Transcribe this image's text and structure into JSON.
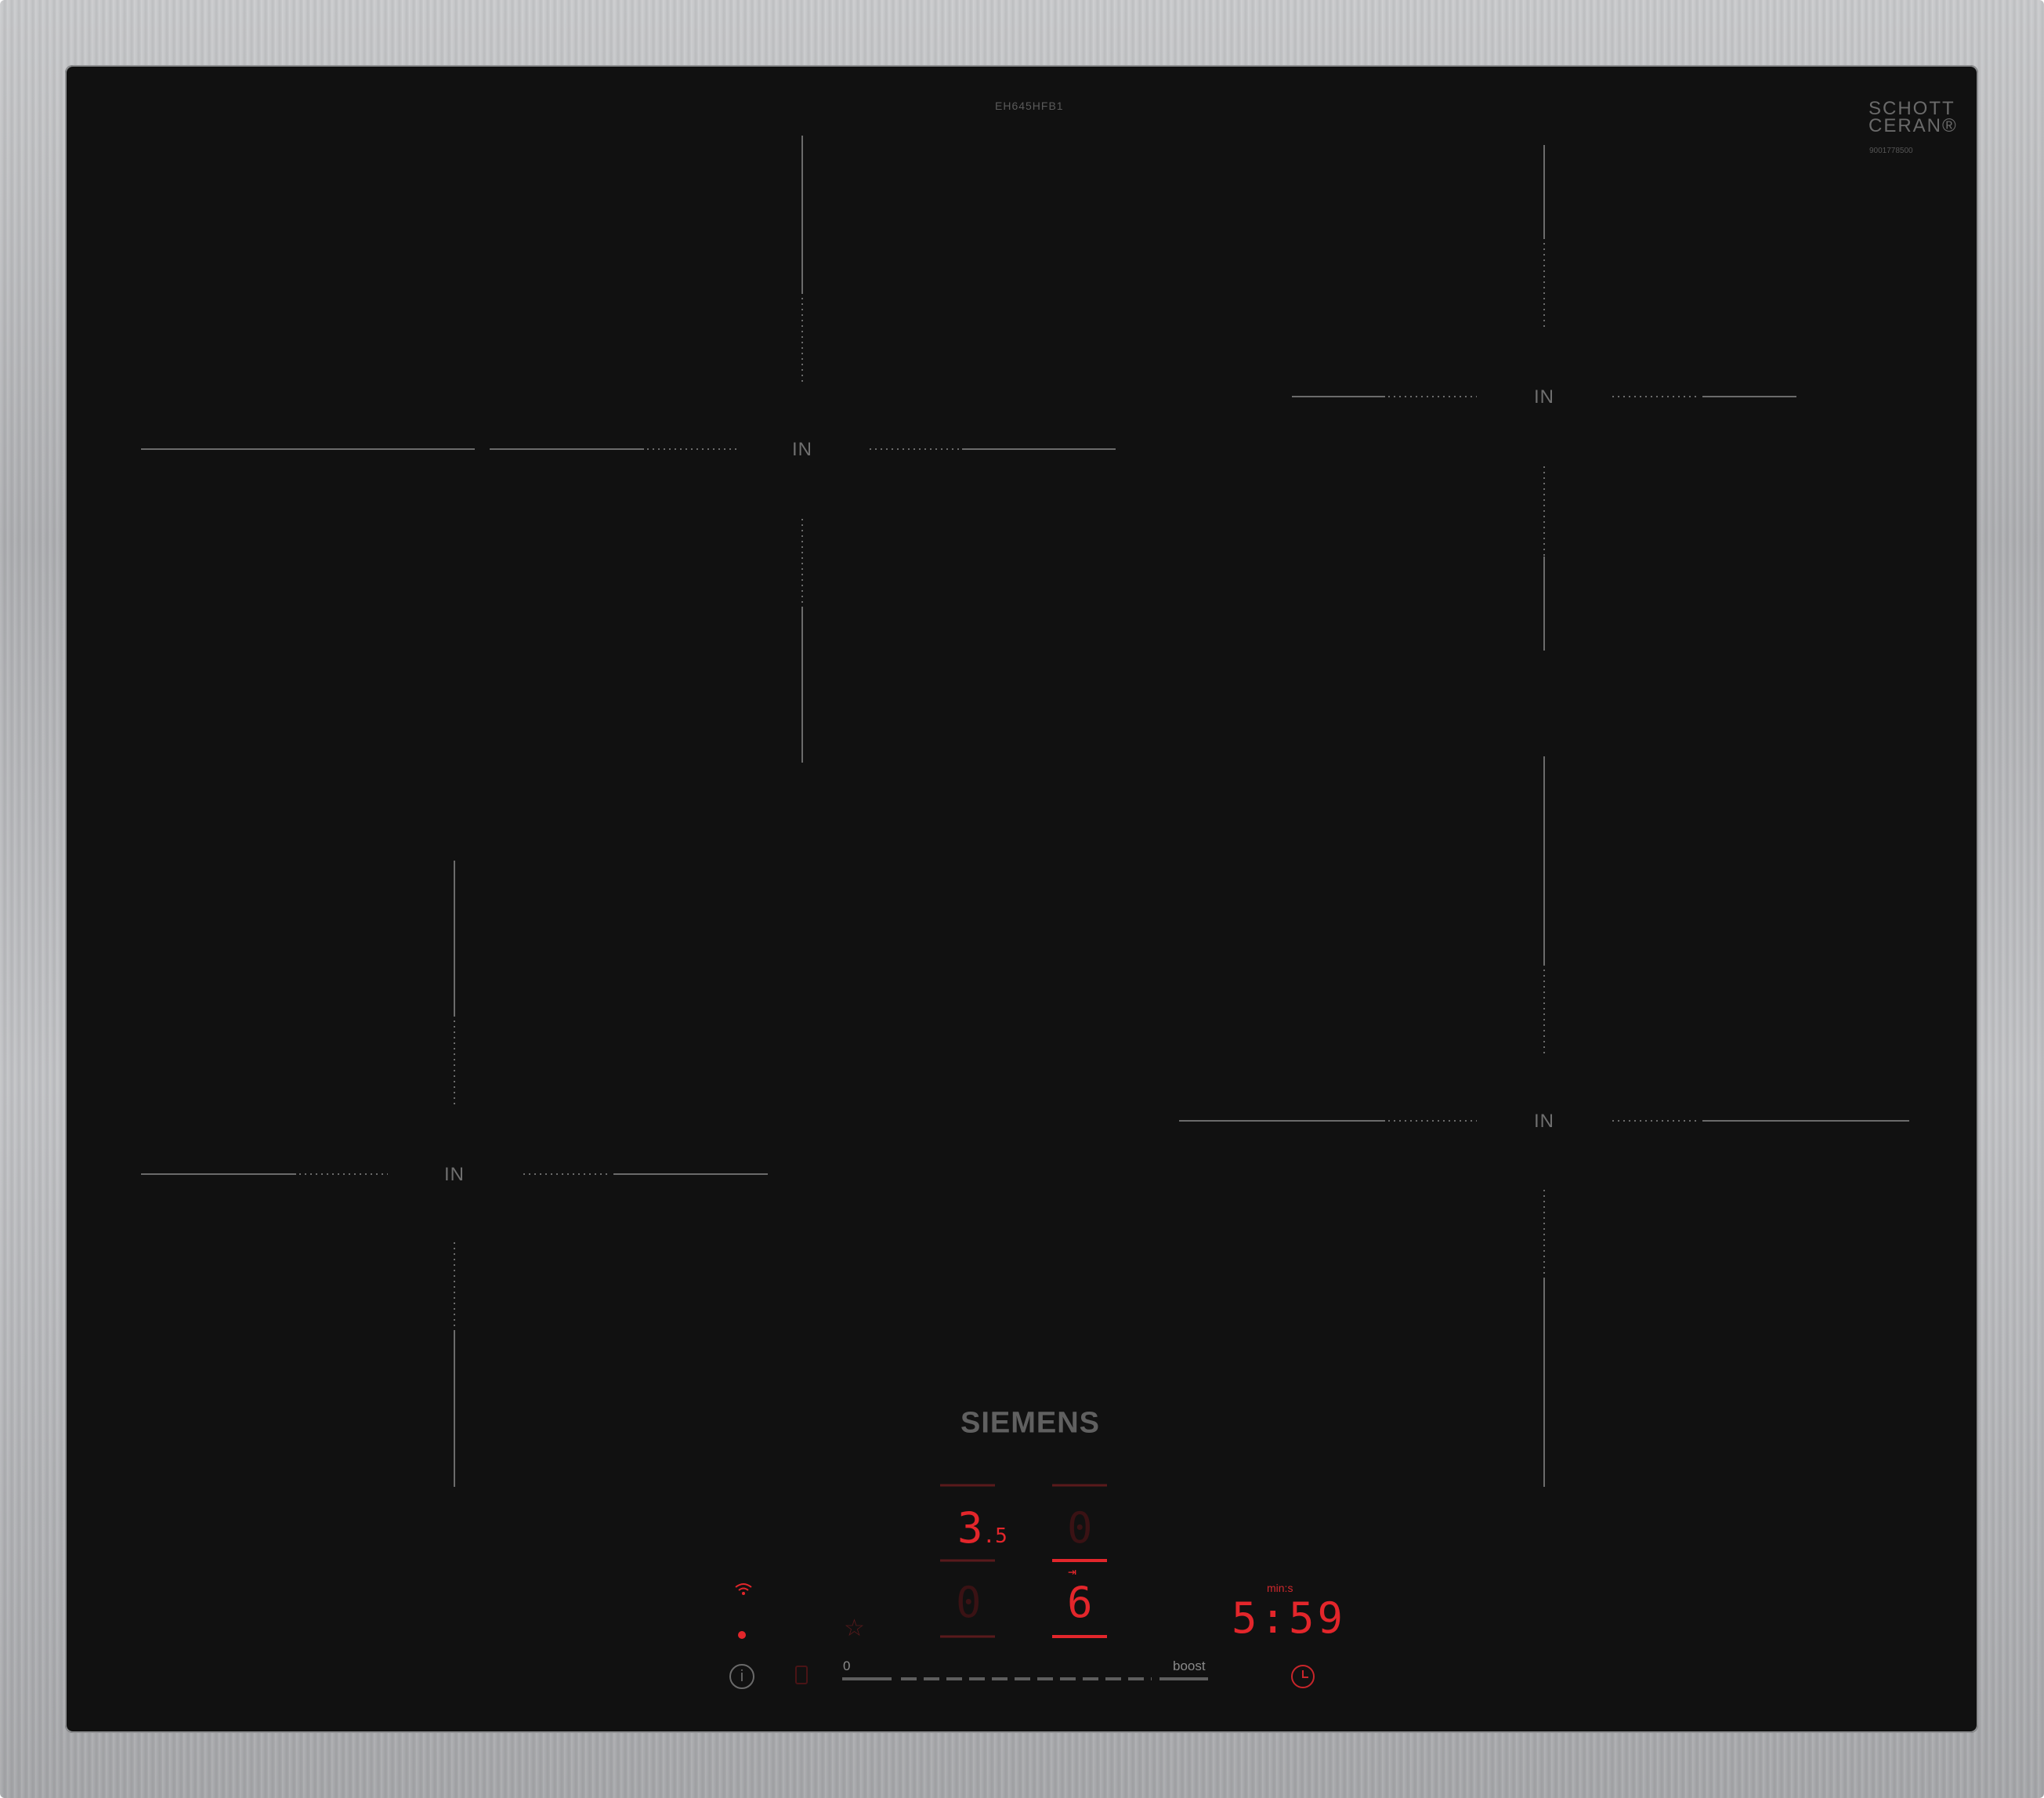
{
  "model": "EH645HFB1",
  "glass_brand": {
    "line1": "SCHOTT",
    "line2": "CERAN®",
    "serial": "9001778500"
  },
  "brand": "SIEMENS",
  "zones": [
    {
      "label": "IN"
    },
    {
      "label": "IN"
    },
    {
      "label": "IN"
    },
    {
      "label": "IN"
    }
  ],
  "displays": {
    "rear_left": {
      "main": "3",
      "decimal": ".5"
    },
    "rear_right": {
      "main": "0"
    },
    "front_left": {
      "main": "0"
    },
    "front_right": {
      "main": "6"
    }
  },
  "timer": {
    "value": "5:59",
    "unit": "min:s"
  },
  "slider": {
    "min_label": "0",
    "max_label": "boost"
  },
  "colors": {
    "accent_red": "#e3262b",
    "glass": "#111111",
    "frame": "#b5b6b9"
  },
  "icons": [
    "wifi-icon",
    "indicator-dot",
    "favourite-star-icon",
    "info-icon",
    "child-lock-icon",
    "timer-clock-icon",
    "power-boost-arrow-icon"
  ]
}
